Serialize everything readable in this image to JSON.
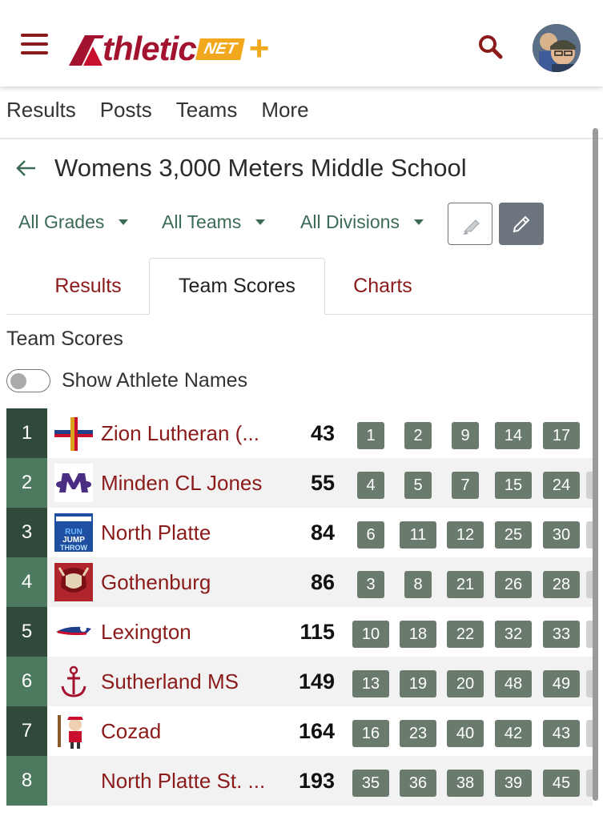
{
  "header": {
    "logo_text": "thletic",
    "logo_net": "NET",
    "logo_plus": "+"
  },
  "subnav": {
    "items": [
      "Results",
      "Posts",
      "Teams",
      "More"
    ]
  },
  "page": {
    "title": "Womens 3,000 Meters Middle School"
  },
  "filters": {
    "grades": "All Grades",
    "teams": "All Teams",
    "divisions": "All Divisions"
  },
  "tabs": [
    {
      "label": "Results",
      "active": false
    },
    {
      "label": "Team Scores",
      "active": true
    },
    {
      "label": "Charts",
      "active": false
    }
  ],
  "section": {
    "title": "Team Scores",
    "toggle_label": "Show Athlete Names"
  },
  "colors": {
    "brand_red": "#8b1a1a",
    "rank_dark": "#2f4a3a",
    "rank_light": "#4d7a5f",
    "chip": "#6a7b6e"
  },
  "teams": [
    {
      "rank": "1",
      "name": "Zion Lutheran (...",
      "score": "43",
      "places": [
        "1",
        "2",
        "9",
        "14",
        "17"
      ],
      "logo": "cross-icon"
    },
    {
      "rank": "2",
      "name": "Minden CL Jones",
      "score": "55",
      "places": [
        "4",
        "5",
        "7",
        "15",
        "24"
      ],
      "logo": "m-logo-icon"
    },
    {
      "rank": "3",
      "name": "North Platte",
      "score": "84",
      "places": [
        "6",
        "11",
        "12",
        "25",
        "30"
      ],
      "logo": "run-jump-throw-icon"
    },
    {
      "rank": "4",
      "name": "Gothenburg",
      "score": "86",
      "places": [
        "3",
        "8",
        "21",
        "26",
        "28"
      ],
      "logo": "viking-icon"
    },
    {
      "rank": "5",
      "name": "Lexington",
      "score": "115",
      "places": [
        "10",
        "18",
        "22",
        "32",
        "33"
      ],
      "logo": "patriot-icon"
    },
    {
      "rank": "6",
      "name": "Sutherland MS",
      "score": "149",
      "places": [
        "13",
        "19",
        "20",
        "48",
        "49"
      ],
      "logo": "anchor-icon"
    },
    {
      "rank": "7",
      "name": "Cozad",
      "score": "164",
      "places": [
        "16",
        "23",
        "40",
        "42",
        "43"
      ],
      "logo": "mascot-icon"
    },
    {
      "rank": "8",
      "name": "North Platte St. ...",
      "score": "193",
      "places": [
        "35",
        "36",
        "38",
        "39",
        "45"
      ],
      "logo": ""
    }
  ]
}
